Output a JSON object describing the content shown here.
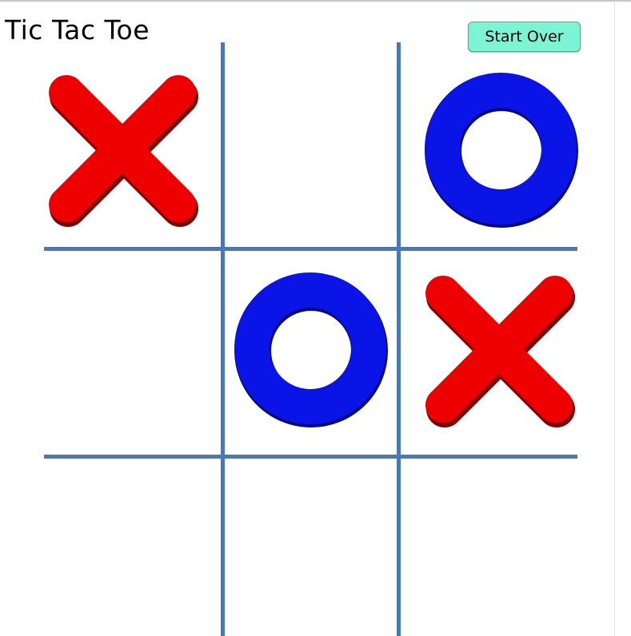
{
  "header": {
    "title": "Tic Tac Toe",
    "start_over_label": "Start Over"
  },
  "colors": {
    "grid_line": "#4a78b8",
    "x_mark": "#ee0000",
    "o_mark": "#0a14e6",
    "button_bg": "#7df5d4"
  },
  "board": {
    "cells": [
      "X",
      "",
      "O",
      "",
      "O",
      "X",
      "",
      "",
      ""
    ]
  }
}
